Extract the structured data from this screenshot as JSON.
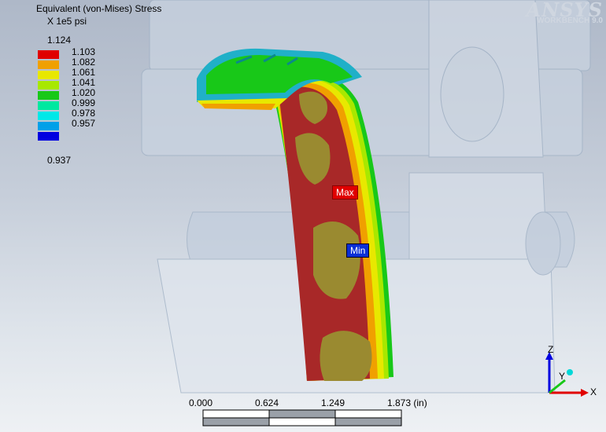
{
  "legend": {
    "title": "Equivalent (von-Mises) Stress",
    "units": "X 1e5 psi",
    "max_label": "1.124",
    "min_label": "0.937",
    "bands": [
      {
        "label": "1.103",
        "color": "#e00000"
      },
      {
        "label": "1.082",
        "color": "#f0a000"
      },
      {
        "label": "1.061",
        "color": "#e8e800"
      },
      {
        "label": "1.041",
        "color": "#a8e800"
      },
      {
        "label": "1.020",
        "color": "#18c818"
      },
      {
        "label": "0.999",
        "color": "#00e8a0"
      },
      {
        "label": "0.978",
        "color": "#00e8e8"
      },
      {
        "label": "0.957",
        "color": "#00a0e8"
      },
      {
        "label": "",
        "color": "#0000e0"
      }
    ]
  },
  "logo": {
    "main": "ANSYS",
    "sub": "WORKBENCH 9.0"
  },
  "probes": {
    "max": "Max",
    "min": "Min"
  },
  "scale": {
    "ticks": [
      "0.000",
      "0.624",
      "1.249",
      "1.873 (in)"
    ]
  },
  "triad": {
    "x": "X",
    "y": "Y",
    "z": "Z"
  }
}
